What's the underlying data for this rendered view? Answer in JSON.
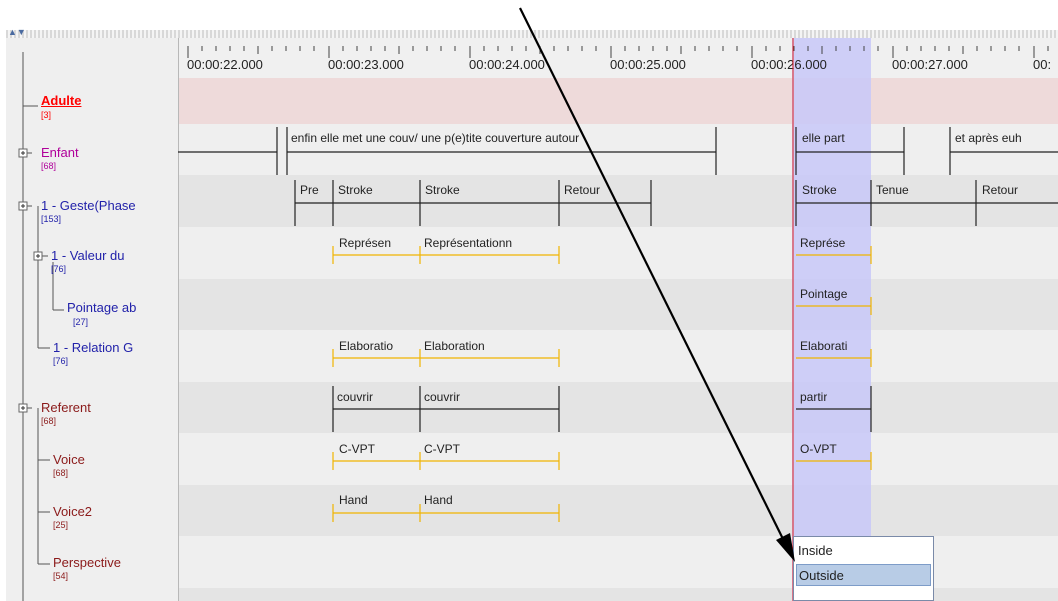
{
  "ruler": {
    "ticks": [
      "00:00:22.000",
      "00:00:23.000",
      "00:00:24.000",
      "00:00:25.000",
      "00:00:26.000",
      "00:00:27.000",
      "00:"
    ]
  },
  "tiers": [
    {
      "name": "Adulte",
      "count": "[3]"
    },
    {
      "name": "Enfant",
      "count": "[68]"
    },
    {
      "name": "1 - Geste(Phase",
      "count": "[153]"
    },
    {
      "name": "1 - Valeur du",
      "count": "[76]"
    },
    {
      "name": "Pointage ab",
      "count": "[27]"
    },
    {
      "name": "1 - Relation G",
      "count": "[76]"
    },
    {
      "name": "Referent",
      "count": "[68]"
    },
    {
      "name": "Voice",
      "count": "[68]"
    },
    {
      "name": "Voice2",
      "count": "[25]"
    },
    {
      "name": "Perspective",
      "count": "[54]"
    }
  ],
  "annotations": {
    "enfant": [
      "enfin elle met une couv/ une p(e)tite couverture autour",
      "elle part",
      "et après euh"
    ],
    "geste": [
      "Pre",
      "Stroke",
      "Stroke",
      "Retour",
      "Stroke",
      "Tenue",
      "Retour"
    ],
    "valeur": [
      "Représen",
      "Représentationn",
      "Représe"
    ],
    "pointage": [
      "Pointage"
    ],
    "relation": [
      "Elaboratio",
      "Elaboration",
      "Elaborati"
    ],
    "referent": [
      "couvrir",
      "couvrir",
      "partir"
    ],
    "voice": [
      "C-VPT",
      "C-VPT",
      "O-VPT"
    ],
    "voice2": [
      "Hand",
      "Hand"
    ]
  },
  "dropdown": {
    "options": [
      "Inside",
      "Outside"
    ],
    "selected": "Outside"
  },
  "colors": {
    "adulte": "#ff0000",
    "enfant": "#b0009a",
    "geste": "#2222aa",
    "referent": "#8b1a1a",
    "crosshair": "#e02020",
    "selection": "#c8c8f8",
    "yellow": "#f0b400"
  }
}
